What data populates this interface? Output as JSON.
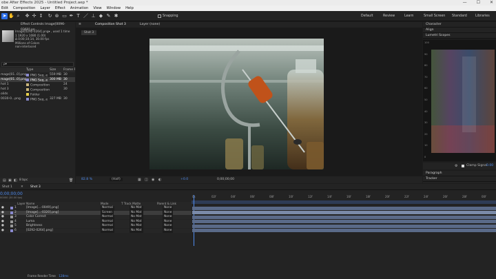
{
  "window": {
    "title": "obe After Effects 2025 - Untitled Project.aep *",
    "min": "—",
    "max": "☐",
    "close": "✕"
  },
  "menu": [
    "Edit",
    "Composition",
    "Layer",
    "Effect",
    "Animation",
    "View",
    "Window",
    "Help"
  ],
  "toolbar": {
    "snapping_label": "Snapping"
  },
  "workspaces": [
    "Default",
    "Review",
    "Learn",
    "Small Screen",
    "Standard",
    "Libraries"
  ],
  "effect_controls": {
    "tab": "Effect Controls Image[0096-0360].pn",
    "item_name": "Image[0292-0264].png▾ , used 1 time",
    "item_size": "1 1920 x 1080 (1.00)",
    "item_fps": "Δ 0;00;10;14, 30.00 fps",
    "item_colors": "Millions of Colors",
    "item_interlace": "non-interlaced"
  },
  "project": {
    "search_placeholder": "ρ▾",
    "columns": [
      "",
      "Type",
      "Size",
      "Frame Ra"
    ],
    "rows": [
      {
        "name": "mage[01..0].png",
        "color": "#8a8ad0",
        "type": "PNG Seq..e",
        "size": "559 MB",
        "fr": "30",
        "selected": false
      },
      {
        "name": "mage[01..0].png",
        "color": "#8a8ad0",
        "type": "PNG Seq..e",
        "size": "300 MB",
        "fr": "30",
        "selected": true
      },
      {
        "name": "hot 1",
        "color": "#c8b47a",
        "type": "Composition",
        "size": "",
        "fr": "24",
        "selected": false
      },
      {
        "name": "hot 3",
        "color": "#c8b47a",
        "type": "Composition",
        "size": "",
        "fr": "30",
        "selected": false
      },
      {
        "name": "olids",
        "color": "#e8d04a",
        "type": "Folder",
        "size": "",
        "fr": "",
        "selected": false
      },
      {
        "name": "0030-0...png",
        "color": "#8a8ad0",
        "type": "PNG Seq..e",
        "size": "327 MB",
        "fr": "30",
        "selected": false
      }
    ],
    "bpc": "8 bpc"
  },
  "composition": {
    "tab": "Composition Shot 3",
    "menu": "≡",
    "layer_tab": "Layer (none)",
    "flow_tab": "Shot 3",
    "zoom": "82.8 %",
    "resolution": "(Half)",
    "exposure": "+0.0",
    "timecode": "0;00;00;00"
  },
  "right_panels": {
    "top": [
      "Character",
      "Align",
      "Lumetri Scopes"
    ],
    "bottom": [
      "Paragraph",
      "Tracker"
    ],
    "scale": [
      "100",
      "90",
      "80",
      "70",
      "60",
      "50",
      "40",
      "30",
      "20",
      "10",
      "0"
    ],
    "clamp_label": "Clamp Signal",
    "clamp_value": "0.00"
  },
  "timeline": {
    "tabs": [
      "Shot 1",
      "Shot 3"
    ],
    "current_time": "0;00;00;00",
    "fps_note": "00000 (30.00 fps)",
    "columns": {
      "layer_name": "Layer Name",
      "mode": "Mode",
      "trk": "T  Track Matte",
      "parent": "Parent & Link"
    },
    "ruler": [
      "0s",
      "02f",
      "04f",
      "06f",
      "08f",
      "10f",
      "12f",
      "14f",
      "16f",
      "18f",
      "20f",
      "22f",
      "24f",
      "26f",
      "28f",
      "00f"
    ],
    "layers": [
      {
        "num": "1",
        "color": "#8a8ad0",
        "name": "[Image[...-0049].png]",
        "mode": "Normal",
        "matte": "No Mat",
        "parent": "None",
        "selected": false
      },
      {
        "num": "2",
        "color": "#8a8ad0",
        "name": "[Image[...-0320].png]",
        "mode": "Screen",
        "matte": "No Mat",
        "parent": "None",
        "selected": true
      },
      {
        "num": "3",
        "color": "#999999",
        "name": "Color Correct",
        "mode": "Normal",
        "matte": "No Mat",
        "parent": "None",
        "selected": false
      },
      {
        "num": "4",
        "color": "#999999",
        "name": "Luma",
        "mode": "Normal",
        "matte": "No Mat",
        "parent": "None",
        "selected": false
      },
      {
        "num": "5",
        "color": "#999999",
        "name": "Brightness",
        "mode": "Normal",
        "matte": "No Mat",
        "parent": "None",
        "selected": false
      },
      {
        "num": "6",
        "color": "#8a8ad0",
        "name": "[0292-0264].png]",
        "mode": "Normal",
        "matte": "No Mat",
        "parent": "None",
        "selected": false
      }
    ],
    "render_label": "Frame Render Time",
    "render_value": "128ms"
  },
  "colors": {
    "accent": "#2c6ee8",
    "timecode": "#4f8cf0"
  }
}
